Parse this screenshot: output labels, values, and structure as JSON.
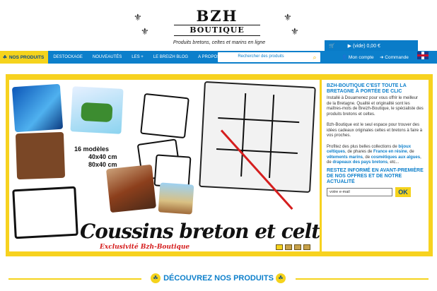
{
  "header": {
    "logo_main": "BZH",
    "logo_sub": "BOUTIQUE",
    "tagline": "Produits bretons, celtes et marins en ligne",
    "cart_icon": "cart-icon",
    "cart_label": "(vide) 0,00 €"
  },
  "nav": {
    "items": [
      {
        "label": "NOS PRODUITS"
      },
      {
        "label": "DESTOCKAGE"
      },
      {
        "label": "NOUVEAUTÉS"
      },
      {
        "label": "LES +"
      },
      {
        "label": "LE BREIZH BLOG"
      },
      {
        "label": "A PROPOS"
      }
    ],
    "search_placeholder": "Rechercher des produits",
    "account_label": "Mon compte",
    "order_label": "Commande",
    "language": "English"
  },
  "banner": {
    "models_line1": "16 modèles",
    "models_line2": "40x40 cm",
    "models_line3": "80x40 cm",
    "title": "Coussins breton et celtes",
    "subtitle": "Exclusivité Bzh-Boutique",
    "slides": 4
  },
  "sidebar": {
    "title": "BZH-BOUTIQUE C'EST TOUTE LA BRETAGNE À PORTÉE DE CLIC",
    "p1": "Installé à Douarnenez pour vous offrir le meilleur de la Bretagne. Qualité et originalité sont les maîtres-mots de Breizh-Boutique, le spécialiste des produits bretons et celtes.",
    "p2": "Bzh-Boutique est le seul espace pour trouver des idées cadeaux originales celtes et bretons à faire à vos proches.",
    "p3_start": "Profitez des plus belles collections de ",
    "p3_link1": "bijoux celtiques",
    "p3_mid1": ", de phares de ",
    "p3_link2": "France en résine",
    "p3_mid2": ", de ",
    "p3_link3": "vêtements marins",
    "p3_mid3": ", de ",
    "p3_link4": "cosmétiques aux algues",
    "p3_mid4": ", de ",
    "p3_link5": "drapeaux des pays bretons",
    "p3_end": ", etc...",
    "newsletter_title": "RESTEZ INFORMÉ EN AVANT-PREMIÈRE DE NOS OFFRES ET DE NOTRE ACTUALITÉ",
    "email_placeholder": "votre e-mail",
    "ok_label": "OK"
  },
  "section": {
    "discover_label": "DÉCOUVREZ NOS PRODUITS"
  },
  "colors": {
    "primary_blue": "#0c7fcb",
    "accent_yellow": "#f5d31c",
    "promo_red": "#d51e1e"
  }
}
